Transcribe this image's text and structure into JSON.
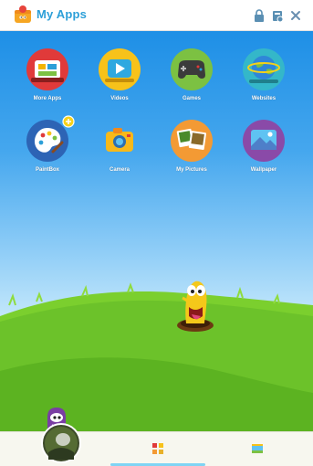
{
  "window": {
    "title": "My Apps",
    "icons": [
      "lock-icon",
      "settings-icon",
      "close-icon"
    ]
  },
  "apps": [
    {
      "label": "More Apps",
      "icon": "more-apps-icon",
      "color": "#e03a3a"
    },
    {
      "label": "Videos",
      "icon": "video-play-icon",
      "color": "#f7c21a"
    },
    {
      "label": "Games",
      "icon": "gamepad-icon",
      "color": "#7cc142"
    },
    {
      "label": "Websites",
      "icon": "globe-icon",
      "color": "#34b7c9"
    },
    {
      "label": "PaintBox",
      "icon": "paint-palette-icon",
      "color": "#2d64b5"
    },
    {
      "label": "Camera",
      "icon": "camera-icon",
      "color": "#39a9e6"
    },
    {
      "label": "My Pictures",
      "icon": "photos-icon",
      "color": "#f39a34"
    },
    {
      "label": "Wallpaper",
      "icon": "wallpaper-icon",
      "color": "#8a4aa8"
    }
  ],
  "colors": {
    "title": "#2c9fd8",
    "grass": "#6cc22a",
    "sky": "#1e8fe6",
    "indicator": "#7fd4f4"
  },
  "bottom_nav": {
    "items": [
      "profile-avatar",
      "apps-grid-icon",
      "wallpaper-tab-icon"
    ]
  }
}
